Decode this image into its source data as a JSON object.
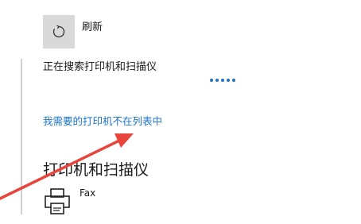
{
  "refresh": {
    "label": "刷新",
    "icon": "refresh-icon"
  },
  "status": {
    "text": "正在搜索打印机和扫描仪",
    "progress_icon": "loading-dots-icon",
    "accent_color": "#1a73c8"
  },
  "link": {
    "text": "我需要的打印机不在列表中",
    "color": "#1a73c8"
  },
  "section": {
    "title": "打印机和扫描仪"
  },
  "printers": [
    {
      "name": "Fax",
      "icon": "printer-icon"
    }
  ],
  "annotation": {
    "icon": "red-arrow-annotation",
    "color": "#e8453c"
  }
}
